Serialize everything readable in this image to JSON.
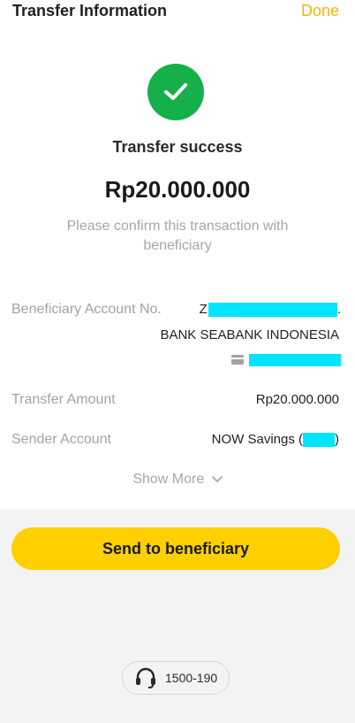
{
  "header": {
    "title": "Transfer Information",
    "done_label": "Done"
  },
  "status": {
    "title": "Transfer success",
    "amount": "Rp20.000.000",
    "message": "Please confirm this transaction with beneficiary"
  },
  "details": {
    "beneficiary_label": "Beneficiary Account No.",
    "beneficiary_prefix": "Z",
    "bank_name": "BANK SEABANK INDONESIA",
    "transfer_amount_label": "Transfer Amount",
    "transfer_amount_value": "Rp20.000.000",
    "sender_label": "Sender Account",
    "sender_value_prefix": "NOW Savings (",
    "sender_value_suffix": ")"
  },
  "show_more_label": "Show More",
  "send_button_label": "Send to beneficiary",
  "support_number": "1500-190",
  "colors": {
    "accent": "#ffd000",
    "success": "#16b04a",
    "done_text": "#f2b705"
  }
}
